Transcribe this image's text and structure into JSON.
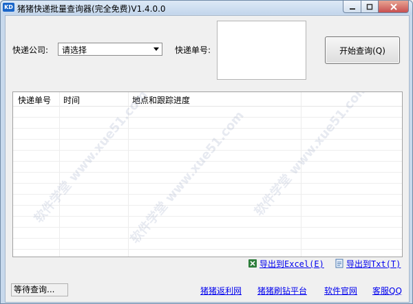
{
  "window": {
    "title": "猪猪快递批量查询器(完全免费)V1.4.0.0",
    "icon_text": "KD"
  },
  "form": {
    "company_label": "快递公司:",
    "company_value": "请选择",
    "number_label": "快递单号:",
    "query_button": "开始查询(Q)"
  },
  "table": {
    "columns": [
      "快递单号",
      "时间",
      "地点和跟踪进度"
    ],
    "rows": []
  },
  "watermark": "软件学堂 www.xue51.com",
  "export": {
    "excel": "导出到Excel(E)",
    "txt": "导出到Txt(T)"
  },
  "footer": {
    "status": "等待查询...",
    "links": [
      "猪猪返利网",
      "猪猪刷钻平台",
      "软件官网",
      "客服QQ"
    ]
  },
  "colors": {
    "link": "#0000ee",
    "titlebar": "#c3d6ec",
    "icon": "#1a66c9"
  }
}
